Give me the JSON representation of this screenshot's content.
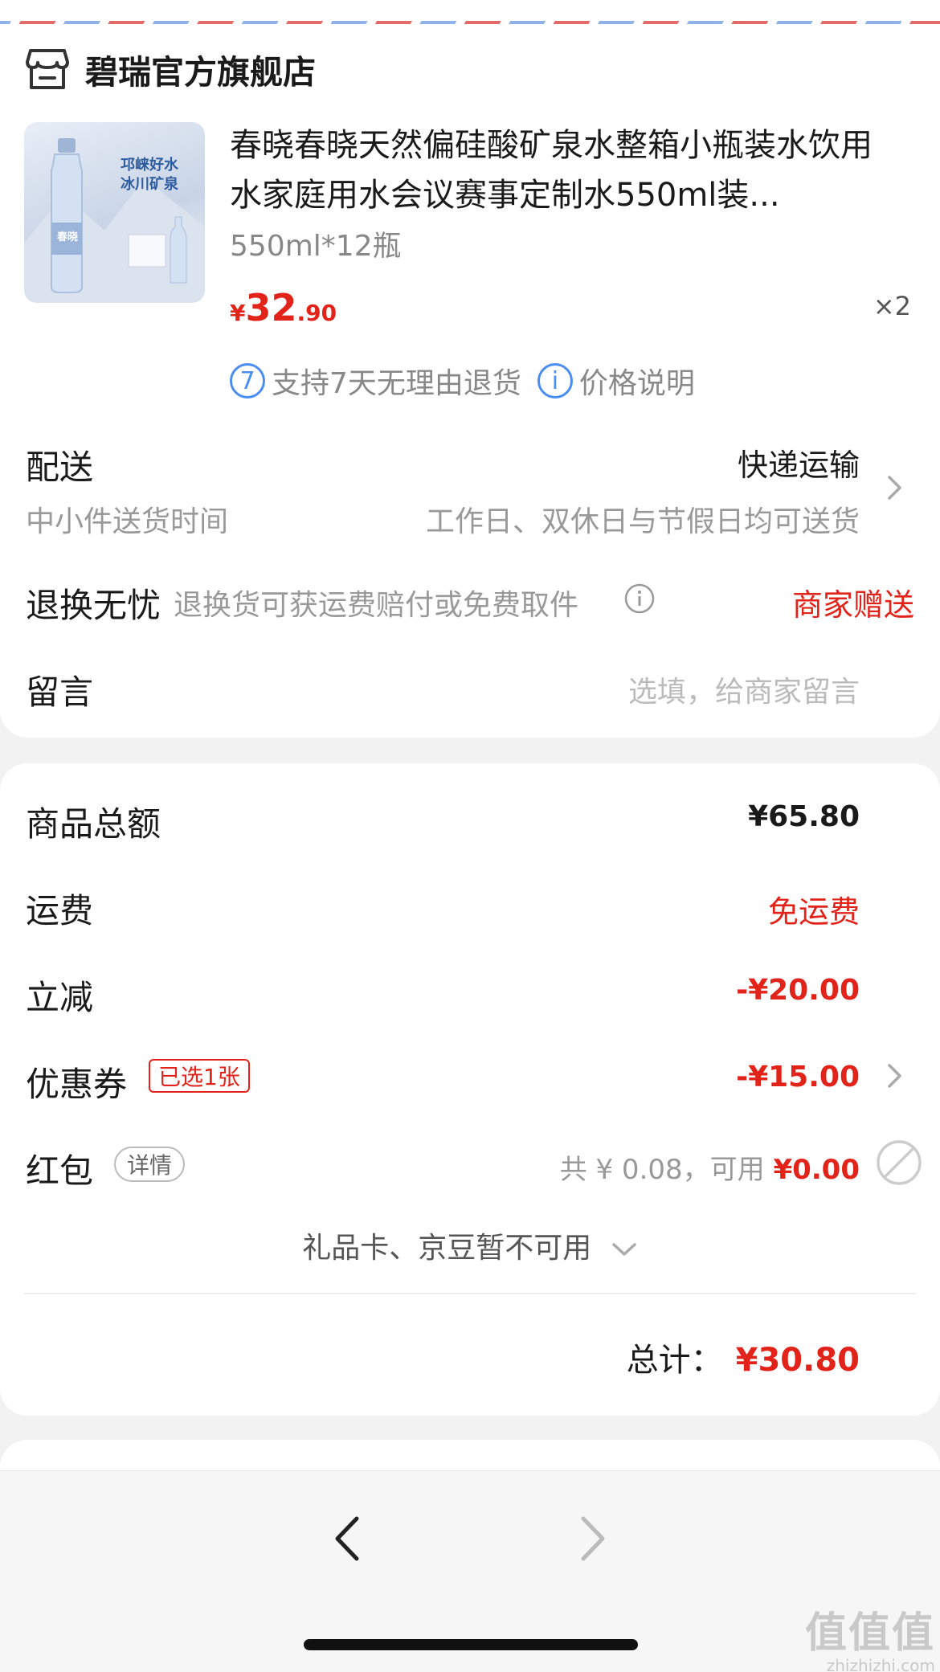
{
  "shop": {
    "name": "碧瑞官方旗舰店",
    "icon": "store-icon"
  },
  "product": {
    "title": "春晓春晓天然偏硅酸矿泉水整箱小瓶装水饮用水家庭用水会议赛事定制水550ml装...",
    "spec": "550ml*12瓶",
    "price_currency": "¥",
    "price_int": "32",
    "price_dec": ".90",
    "quantity": "×2",
    "image_caption_1": "邛崃好水",
    "image_caption_2": "冰川矿泉",
    "image_brand": "春晓"
  },
  "service_tags": [
    {
      "icon_char": "7",
      "icon": "seven-day-return-icon",
      "label": "支持7天无理由退货"
    },
    {
      "icon_char": "i",
      "icon": "info-icon",
      "label": "价格说明"
    }
  ],
  "delivery": {
    "label": "配送",
    "method": "快递运输",
    "sub_label": "中小件送货时间",
    "sub_value": "工作日、双休日与节假日均可送货"
  },
  "return_worry_free": {
    "label": "退换无忧",
    "desc": "退换货可获运费赔付或免费取件",
    "value": "商家赠送"
  },
  "message": {
    "label": "留言",
    "placeholder": "选填，给商家留言"
  },
  "summary": {
    "goods_total_label": "商品总额",
    "goods_total_value": "¥65.80",
    "shipping_label": "运费",
    "shipping_value": "免运费",
    "instant_discount_label": "立减",
    "instant_discount_value": "-¥20.00",
    "coupon_label": "优惠券",
    "coupon_badge": "已选1张",
    "coupon_value": "-¥15.00",
    "red_packet_label": "红包",
    "red_packet_detail": "详情",
    "red_packet_total": "共 ¥ 0.08，可用 ",
    "red_packet_usable": "¥0.00",
    "unavailable_text": "礼品卡、京豆暂不可用",
    "total_label": "总计：",
    "total_value": "¥30.80"
  },
  "watermark": {
    "big": "值值值",
    "small": "zhizhizhi.com"
  },
  "colors": {
    "accent_red": "#e2231a",
    "info_blue": "#4a8ef0",
    "text_gray": "#999999"
  }
}
